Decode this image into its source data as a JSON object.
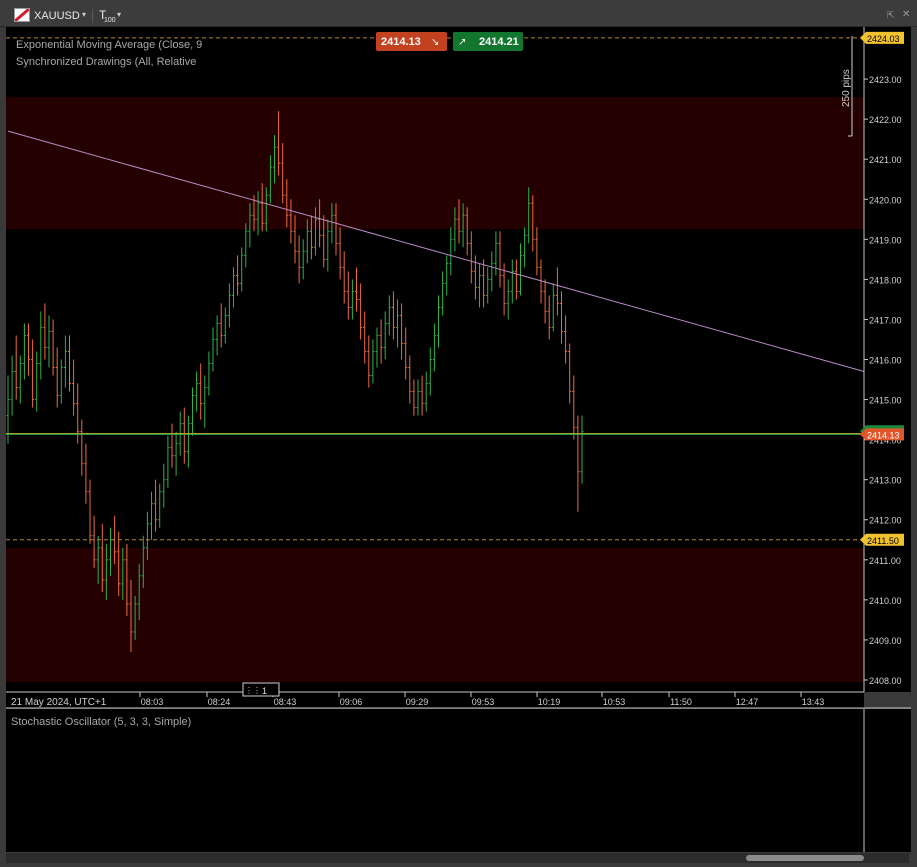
{
  "toolbar": {
    "symbol": "XAUUSD",
    "symbol_dropdown_icon": "chevron-down-icon",
    "timeframe_main": "T",
    "timeframe_sub": "100",
    "timeframe_dropdown_icon": "chevron-down-icon",
    "detach_icon": "detach-icon",
    "close_icon": "close-icon"
  },
  "colors": {
    "background": "#000000",
    "zone": "#240000",
    "bull": "#2fb04e",
    "bear": "#ef6a44",
    "trendline": "#b98ac6",
    "ema": "#d4b233",
    "bid_badge": "#e0562a",
    "ask_badge": "#1a8a3c",
    "limit_badge": "#f2c12e",
    "sell_button": "#c2411f",
    "buy_button": "#13762f"
  },
  "indicators": {
    "ema_label": "Exponential Moving Average (Close, 9",
    "sync_label": "Synchronized Drawings (All, Relative",
    "stochastic_label": "Stochastic Oscillator (5, 3, 3, Simple)"
  },
  "quick_trade": {
    "sell_price": "2414.13",
    "buy_price": "2414.21"
  },
  "measure": {
    "label": "250 pips"
  },
  "price_axis": {
    "tick_labels": [
      "2423.00",
      "2422.00",
      "2421.00",
      "2420.00",
      "2419.00",
      "2418.00",
      "2417.00",
      "2416.00",
      "2415.00",
      "2414.00",
      "2413.00",
      "2412.00",
      "2411.00",
      "2410.00",
      "2409.00",
      "2408.00"
    ],
    "upper_badge": "2424.03",
    "bid_badge": "2414.13",
    "ask_badge": "2414.21",
    "lower_badge": "2411.50"
  },
  "time_axis": {
    "date_label": "21 May 2024, UTC+1",
    "tick_labels": [
      "08:03",
      "08:24",
      "08:43",
      "09:06",
      "09:29",
      "09:53",
      "10:19",
      "10:53",
      "11:50",
      "12:47",
      "13:43"
    ],
    "marker_label": "1"
  },
  "chart_data": {
    "type": "bar",
    "symbol": "XAUUSD",
    "timeframe": "T100",
    "ylim": [
      2407.7,
      2424.3
    ],
    "grid": false,
    "levels": {
      "upper_dashed": 2424.03,
      "lower_dashed": 2411.5,
      "bid": 2414.13,
      "ask": 2414.21,
      "ema_last": 2414.15
    },
    "zones": [
      {
        "from": 2419.25,
        "to": 2422.55
      },
      {
        "from": 2407.95,
        "to": 2411.3
      }
    ],
    "trendline": {
      "start": {
        "bar": 0,
        "price": 2421.7
      },
      "end_price": 2415.7
    },
    "bars": [
      [
        2414.6,
        2415.6,
        2413.9,
        2415.0
      ],
      [
        2415.0,
        2416.1,
        2414.6,
        2415.7
      ],
      [
        2415.7,
        2416.6,
        2415.0,
        2415.3
      ],
      [
        2415.3,
        2416.1,
        2414.9,
        2415.9
      ],
      [
        2415.9,
        2416.9,
        2415.5,
        2416.6
      ],
      [
        2416.6,
        2416.9,
        2415.6,
        2416.0
      ],
      [
        2416.0,
        2416.5,
        2414.8,
        2415.0
      ],
      [
        2415.0,
        2416.2,
        2414.7,
        2415.9
      ],
      [
        2415.9,
        2417.2,
        2415.5,
        2416.8
      ],
      [
        2416.8,
        2417.4,
        2416.0,
        2416.3
      ],
      [
        2416.3,
        2417.1,
        2415.8,
        2416.7
      ],
      [
        2416.7,
        2417.0,
        2415.6,
        2415.8
      ],
      [
        2415.8,
        2416.3,
        2414.8,
        2415.1
      ],
      [
        2415.1,
        2416.0,
        2414.9,
        2415.8
      ],
      [
        2415.8,
        2416.6,
        2415.3,
        2416.2
      ],
      [
        2416.2,
        2416.6,
        2415.2,
        2415.4
      ],
      [
        2415.4,
        2416.0,
        2414.6,
        2414.9
      ],
      [
        2414.9,
        2415.4,
        2413.9,
        2414.2
      ],
      [
        2414.2,
        2414.5,
        2413.1,
        2413.4
      ],
      [
        2413.4,
        2413.9,
        2412.4,
        2412.7
      ],
      [
        2412.7,
        2413.0,
        2411.4,
        2411.6
      ],
      [
        2411.6,
        2412.1,
        2410.8,
        2411.0
      ],
      [
        2411.0,
        2411.6,
        2410.4,
        2411.3
      ],
      [
        2411.3,
        2411.9,
        2410.2,
        2410.5
      ],
      [
        2410.5,
        2411.4,
        2410.0,
        2411.0
      ],
      [
        2411.0,
        2411.8,
        2410.6,
        2411.5
      ],
      [
        2411.5,
        2412.1,
        2410.9,
        2411.2
      ],
      [
        2411.2,
        2411.7,
        2410.1,
        2410.4
      ],
      [
        2410.4,
        2411.3,
        2410.0,
        2411.0
      ],
      [
        2411.0,
        2411.4,
        2409.6,
        2409.9
      ],
      [
        2409.9,
        2410.5,
        2408.7,
        2409.2
      ],
      [
        2409.2,
        2410.1,
        2409.0,
        2409.9
      ],
      [
        2409.9,
        2410.9,
        2409.5,
        2410.6
      ],
      [
        2410.6,
        2411.6,
        2410.3,
        2411.3
      ],
      [
        2411.3,
        2412.2,
        2411.0,
        2411.9
      ],
      [
        2411.9,
        2412.7,
        2411.5,
        2412.4
      ],
      [
        2412.4,
        2413.0,
        2411.7,
        2412.0
      ],
      [
        2412.0,
        2412.9,
        2411.8,
        2412.7
      ],
      [
        2412.7,
        2413.4,
        2412.3,
        2413.0
      ],
      [
        2413.0,
        2414.1,
        2412.8,
        2413.8
      ],
      [
        2413.8,
        2414.4,
        2413.3,
        2413.6
      ],
      [
        2413.6,
        2414.2,
        2413.1,
        2413.9
      ],
      [
        2413.9,
        2414.7,
        2413.6,
        2414.4
      ],
      [
        2414.4,
        2414.8,
        2413.4,
        2413.7
      ],
      [
        2413.7,
        2414.6,
        2413.3,
        2414.4
      ],
      [
        2414.4,
        2415.3,
        2414.1,
        2415.1
      ],
      [
        2415.1,
        2415.7,
        2414.7,
        2415.4
      ],
      [
        2415.4,
        2415.9,
        2414.5,
        2414.9
      ],
      [
        2414.9,
        2415.6,
        2414.3,
        2415.3
      ],
      [
        2415.3,
        2416.2,
        2415.1,
        2415.9
      ],
      [
        2415.9,
        2416.8,
        2415.7,
        2416.5
      ],
      [
        2416.5,
        2417.1,
        2416.1,
        2416.9
      ],
      [
        2416.9,
        2417.4,
        2416.3,
        2416.6
      ],
      [
        2416.6,
        2417.3,
        2416.4,
        2417.1
      ],
      [
        2417.1,
        2417.9,
        2416.8,
        2417.6
      ],
      [
        2417.6,
        2418.3,
        2417.3,
        2418.1
      ],
      [
        2418.1,
        2418.6,
        2417.6,
        2417.9
      ],
      [
        2417.9,
        2418.8,
        2417.7,
        2418.6
      ],
      [
        2418.6,
        2419.4,
        2418.3,
        2419.2
      ],
      [
        2419.2,
        2419.9,
        2418.8,
        2419.6
      ],
      [
        2419.6,
        2420.1,
        2419.2,
        2419.5
      ],
      [
        2419.5,
        2420.2,
        2419.1,
        2419.9
      ],
      [
        2419.9,
        2420.4,
        2419.2,
        2419.4
      ],
      [
        2419.4,
        2420.3,
        2419.2,
        2420.1
      ],
      [
        2420.1,
        2421.1,
        2419.9,
        2420.8
      ],
      [
        2420.8,
        2421.6,
        2420.4,
        2421.3
      ],
      [
        2421.3,
        2422.2,
        2420.6,
        2420.9
      ],
      [
        2420.9,
        2421.4,
        2419.9,
        2420.1
      ],
      [
        2420.1,
        2420.5,
        2419.3,
        2419.6
      ],
      [
        2419.6,
        2420.0,
        2418.9,
        2419.2
      ],
      [
        2419.2,
        2419.6,
        2418.4,
        2418.7
      ],
      [
        2418.7,
        2419.1,
        2417.9,
        2418.3
      ],
      [
        2418.3,
        2419.0,
        2418.0,
        2418.7
      ],
      [
        2418.7,
        2419.5,
        2418.4,
        2419.2
      ],
      [
        2419.2,
        2419.6,
        2418.5,
        2418.8
      ],
      [
        2418.8,
        2419.8,
        2418.6,
        2419.5
      ],
      [
        2419.5,
        2420.0,
        2418.8,
        2419.1
      ],
      [
        2419.1,
        2419.6,
        2418.3,
        2418.5
      ],
      [
        2418.5,
        2419.5,
        2418.2,
        2419.2
      ],
      [
        2419.2,
        2419.9,
        2418.9,
        2419.6
      ],
      [
        2419.6,
        2419.9,
        2418.6,
        2418.9
      ],
      [
        2418.9,
        2419.3,
        2418.0,
        2418.3
      ],
      [
        2418.3,
        2418.7,
        2417.4,
        2417.7
      ],
      [
        2417.7,
        2418.2,
        2417.0,
        2417.3
      ],
      [
        2417.3,
        2418.0,
        2417.0,
        2417.7
      ],
      [
        2417.7,
        2418.3,
        2417.2,
        2417.5
      ],
      [
        2417.5,
        2417.9,
        2416.5,
        2416.8
      ],
      [
        2416.8,
        2417.2,
        2415.9,
        2416.2
      ],
      [
        2416.2,
        2416.6,
        2415.3,
        2415.6
      ],
      [
        2415.6,
        2416.5,
        2415.4,
        2416.2
      ],
      [
        2416.2,
        2416.8,
        2415.8,
        2416.6
      ],
      [
        2416.6,
        2417.0,
        2415.9,
        2416.3
      ],
      [
        2416.3,
        2417.2,
        2416.0,
        2416.9
      ],
      [
        2416.9,
        2417.6,
        2416.6,
        2417.3
      ],
      [
        2417.3,
        2417.7,
        2416.5,
        2416.8
      ],
      [
        2416.8,
        2417.5,
        2416.3,
        2417.1
      ],
      [
        2417.1,
        2417.4,
        2416.0,
        2416.4
      ],
      [
        2416.4,
        2416.8,
        2415.5,
        2415.8
      ],
      [
        2415.8,
        2416.1,
        2414.9,
        2415.2
      ],
      [
        2415.2,
        2415.5,
        2414.6,
        2414.8
      ],
      [
        2414.8,
        2415.5,
        2414.6,
        2415.2
      ],
      [
        2415.2,
        2415.6,
        2414.6,
        2414.9
      ],
      [
        2414.9,
        2415.7,
        2414.7,
        2415.4
      ],
      [
        2415.4,
        2416.3,
        2415.1,
        2416.0
      ],
      [
        2416.0,
        2416.9,
        2415.7,
        2416.6
      ],
      [
        2416.6,
        2417.6,
        2416.3,
        2417.3
      ],
      [
        2417.3,
        2418.2,
        2417.1,
        2417.9
      ],
      [
        2417.9,
        2418.6,
        2417.6,
        2418.4
      ],
      [
        2418.4,
        2419.3,
        2418.1,
        2419.0
      ],
      [
        2419.0,
        2419.8,
        2418.7,
        2419.5
      ],
      [
        2419.5,
        2420.0,
        2418.9,
        2419.2
      ],
      [
        2419.2,
        2419.9,
        2418.8,
        2419.6
      ],
      [
        2419.6,
        2419.8,
        2418.6,
        2418.9
      ],
      [
        2418.9,
        2419.2,
        2417.9,
        2418.2
      ],
      [
        2418.2,
        2418.6,
        2417.5,
        2417.8
      ],
      [
        2417.8,
        2418.4,
        2417.3,
        2418.1
      ],
      [
        2418.1,
        2418.5,
        2417.3,
        2417.6
      ],
      [
        2417.6,
        2418.3,
        2417.4,
        2418.0
      ],
      [
        2418.0,
        2418.7,
        2417.7,
        2418.4
      ],
      [
        2418.4,
        2419.2,
        2418.1,
        2418.9
      ],
      [
        2418.9,
        2419.2,
        2417.8,
        2418.1
      ],
      [
        2418.1,
        2418.4,
        2417.1,
        2417.4
      ],
      [
        2417.4,
        2418.0,
        2417.0,
        2417.7
      ],
      [
        2417.7,
        2418.5,
        2417.4,
        2418.2
      ],
      [
        2418.2,
        2418.5,
        2417.5,
        2417.7
      ],
      [
        2417.7,
        2418.9,
        2417.6,
        2418.6
      ],
      [
        2418.6,
        2419.3,
        2418.3,
        2419.1
      ],
      [
        2419.1,
        2420.3,
        2418.9,
        2419.9
      ],
      [
        2419.9,
        2420.1,
        2418.7,
        2419.0
      ],
      [
        2419.0,
        2419.3,
        2418.1,
        2418.3
      ],
      [
        2418.3,
        2418.5,
        2417.4,
        2417.7
      ],
      [
        2417.7,
        2418.0,
        2416.9,
        2417.2
      ],
      [
        2417.2,
        2417.6,
        2416.5,
        2416.8
      ],
      [
        2416.8,
        2417.9,
        2416.7,
        2417.6
      ],
      [
        2417.6,
        2418.3,
        2417.1,
        2417.4
      ],
      [
        2417.4,
        2417.7,
        2416.4,
        2416.7
      ],
      [
        2416.7,
        2417.1,
        2415.9,
        2416.2
      ],
      [
        2416.2,
        2416.4,
        2414.9,
        2415.2
      ],
      [
        2415.2,
        2415.6,
        2414.0,
        2414.3
      ],
      [
        2414.3,
        2414.6,
        2412.2,
        2413.2
      ],
      [
        2413.2,
        2414.6,
        2412.9,
        2414.2
      ]
    ]
  }
}
